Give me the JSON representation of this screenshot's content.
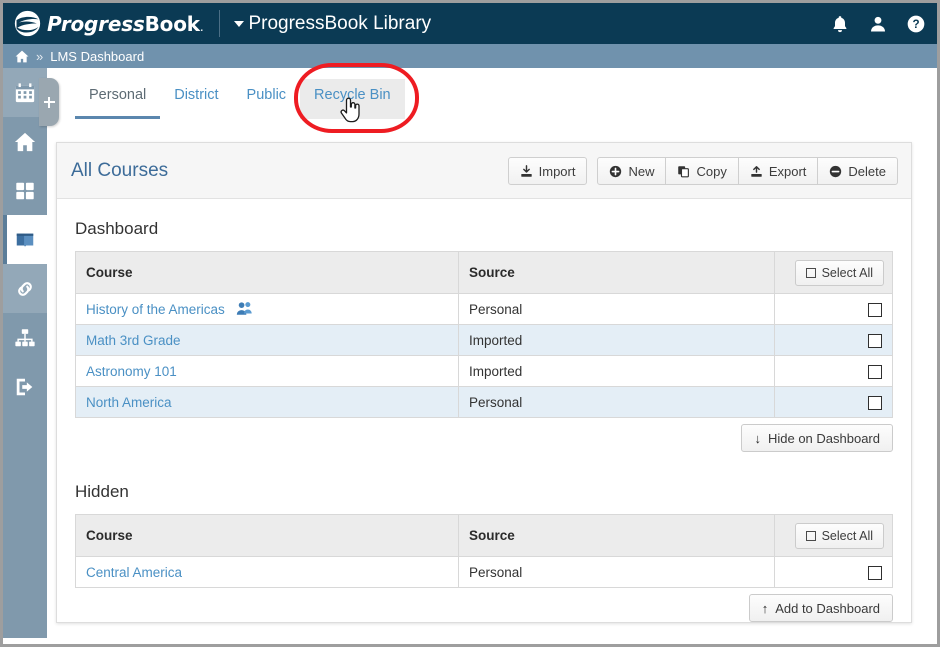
{
  "header": {
    "logo_icon": "progressbook-swoosh-logo",
    "logo_text_progress": "Progress",
    "logo_text_book": "Book",
    "logo_text_dot": ".",
    "app_title": "ProgressBook Library",
    "icons": [
      {
        "name": "notifications-bell-icon",
        "glyph": "bell"
      },
      {
        "name": "user-account-icon",
        "glyph": "user"
      },
      {
        "name": "help-icon",
        "glyph": "question-circle"
      }
    ]
  },
  "breadcrumb": {
    "home_icon": "home-icon",
    "separator": "»",
    "current": "LMS Dashboard"
  },
  "sidebar": {
    "expander_label": "+",
    "items": [
      {
        "name": "sidebar-item-calendar",
        "icon": "calendar-icon",
        "state": "tint"
      },
      {
        "name": "sidebar-item-home",
        "icon": "home-icon",
        "state": "normal"
      },
      {
        "name": "sidebar-item-apps",
        "icon": "grid-apps-icon",
        "state": "normal"
      },
      {
        "name": "sidebar-item-library",
        "icon": "book-icon",
        "state": "active"
      },
      {
        "name": "sidebar-item-links",
        "icon": "chain-link-icon",
        "state": "tint"
      },
      {
        "name": "sidebar-item-org-chart",
        "icon": "sitemap-icon",
        "state": "normal"
      },
      {
        "name": "sidebar-item-logout",
        "icon": "logout-icon",
        "state": "normal"
      }
    ]
  },
  "tabs": [
    {
      "label": "Personal",
      "state": "active"
    },
    {
      "label": "District",
      "state": "normal"
    },
    {
      "label": "Public",
      "state": "normal"
    },
    {
      "label": "Recycle Bin",
      "state": "hovered"
    }
  ],
  "annotation": {
    "shape": "red-ellipse-highlight",
    "color": "#ee1c22",
    "target": "Recycle Bin",
    "cursor": "pointing-hand-cursor"
  },
  "panel": {
    "title": "All Courses",
    "toolbar": {
      "import": {
        "label": "Import",
        "icon": "import-download-icon"
      },
      "new": {
        "label": "New",
        "icon": "plus-circle-icon"
      },
      "copy": {
        "label": "Copy",
        "icon": "copy-pages-icon"
      },
      "export": {
        "label": "Export",
        "icon": "export-upload-icon"
      },
      "delete": {
        "label": "Delete",
        "icon": "minus-circle-icon"
      }
    }
  },
  "sections": [
    {
      "title": "Dashboard",
      "columns": [
        "Course",
        "Source",
        ""
      ],
      "select_all_label": "Select All",
      "rows": [
        {
          "course": "History of the Americas",
          "source": "Personal",
          "shared": true,
          "checked": false
        },
        {
          "course": "Math 3rd Grade",
          "source": "Imported",
          "shared": false,
          "checked": false
        },
        {
          "course": "Astronomy 101",
          "source": "Imported",
          "shared": false,
          "checked": false
        },
        {
          "course": "North America",
          "source": "Personal",
          "shared": false,
          "checked": false
        }
      ],
      "footer_button": {
        "label": "Hide on Dashboard",
        "icon": "arrow-down-icon",
        "glyph": "↓"
      }
    },
    {
      "title": "Hidden",
      "columns": [
        "Course",
        "Source",
        ""
      ],
      "select_all_label": "Select All",
      "rows": [
        {
          "course": "Central America",
          "source": "Personal",
          "shared": false,
          "checked": false
        }
      ],
      "footer_button": {
        "label": "Add to Dashboard",
        "icon": "arrow-up-icon",
        "glyph": "↑"
      }
    }
  ],
  "colors": {
    "header_bg": "#0b3a54",
    "breadcrumb_bg": "#7092ad",
    "sidebar_bg": "#8099ac",
    "link_blue": "#4a90c4",
    "title_blue": "#3d6c99",
    "row_alt_bg": "#e4eef6",
    "annotation_red": "#ee1c22"
  }
}
